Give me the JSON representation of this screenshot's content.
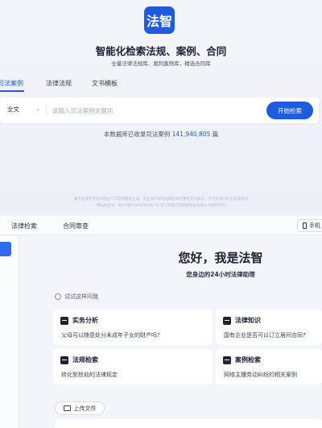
{
  "brand": {
    "logo_text": "法智"
  },
  "hero": {
    "title": "智能化检索法规、案例、合同",
    "subtitle": "全量法律法规库、裁判案例库，精选合同库"
  },
  "search_tabs": [
    {
      "label": "司法案例",
      "active": true
    },
    {
      "label": "法律法规",
      "active": false
    },
    {
      "label": "文书模板",
      "active": false
    }
  ],
  "search": {
    "scope": "全文",
    "placeholder": "请输入司法案例关键词",
    "button": "开始检索",
    "db_prefix": "本数据库已收录司法案例",
    "db_count": "141,940,805",
    "db_suffix": "篇"
  },
  "disclaimer": {
    "line1": "服务名或您所有内容由人工智能模型生成，其生成内容的准确性和完整性无法保证，不代表我们的态度或观点",
    "line2": "网站备案号：浙ICP备10056399号-35    浙江阿里巴巴网络科技有限公司版权所有"
  },
  "chat_tabs": [
    {
      "label": "法律检索"
    },
    {
      "label": "合同审查"
    }
  ],
  "mobile_button": "手机",
  "greeting": {
    "title": "您好，我是法智",
    "subtitle": "您身边的24小时法律助理"
  },
  "try_label": "试试这样问我",
  "cards": [
    {
      "title": "实务分析",
      "desc": "父母可以随意处分未成年子女的财产吗?"
    },
    {
      "title": "法律知识",
      "desc": "国有企业是否可以订立居间合同?"
    },
    {
      "title": "法规检索",
      "desc": "转化型抢劫的法律规定"
    },
    {
      "title": "案例检索",
      "desc": "网络主播劳动纠纷的相关案例"
    }
  ],
  "upload_button": "上传文件",
  "colors": {
    "accent": "#1f5be0",
    "background": "#eef1f7"
  }
}
